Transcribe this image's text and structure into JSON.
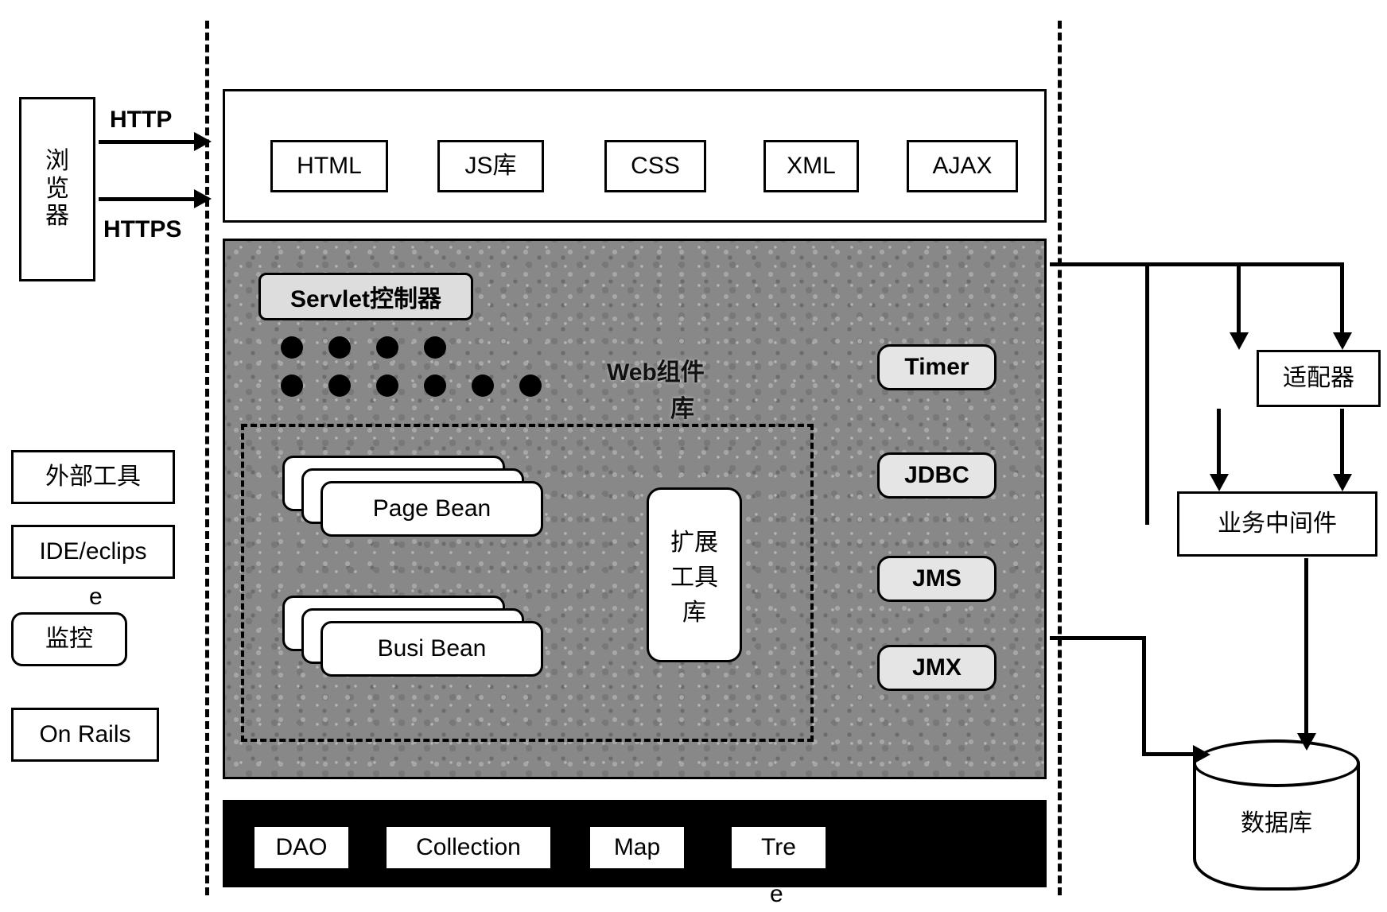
{
  "left": {
    "browser": "浏\n览\n器",
    "proto_http": "HTTP",
    "proto_https": "HTTPS",
    "ext_tools": "外部工具",
    "ide": "IDE/eclips",
    "ide_tail": "e",
    "monitor": "监控",
    "on_rails": "On Rails"
  },
  "top_row": {
    "items": [
      "HTML",
      "JS库",
      "CSS",
      "XML",
      "AJAX"
    ]
  },
  "middle": {
    "servlet": "Servlet控制器",
    "web_comp_title": "Web组件",
    "web_comp_sub": "库",
    "page_bean": "Page Bean",
    "busi_bean": "Busi Bean",
    "tool_lib": "扩展\n工具\n库",
    "right_pills": [
      "Timer",
      "JDBC",
      "JMS",
      "JMX"
    ]
  },
  "bottom": {
    "items": [
      "DAO",
      "Collection",
      "Map",
      "Tre"
    ],
    "overflow_e": "e"
  },
  "right": {
    "adapter": "适配器",
    "biz_mw": "业务中间件",
    "database": "数据库"
  }
}
